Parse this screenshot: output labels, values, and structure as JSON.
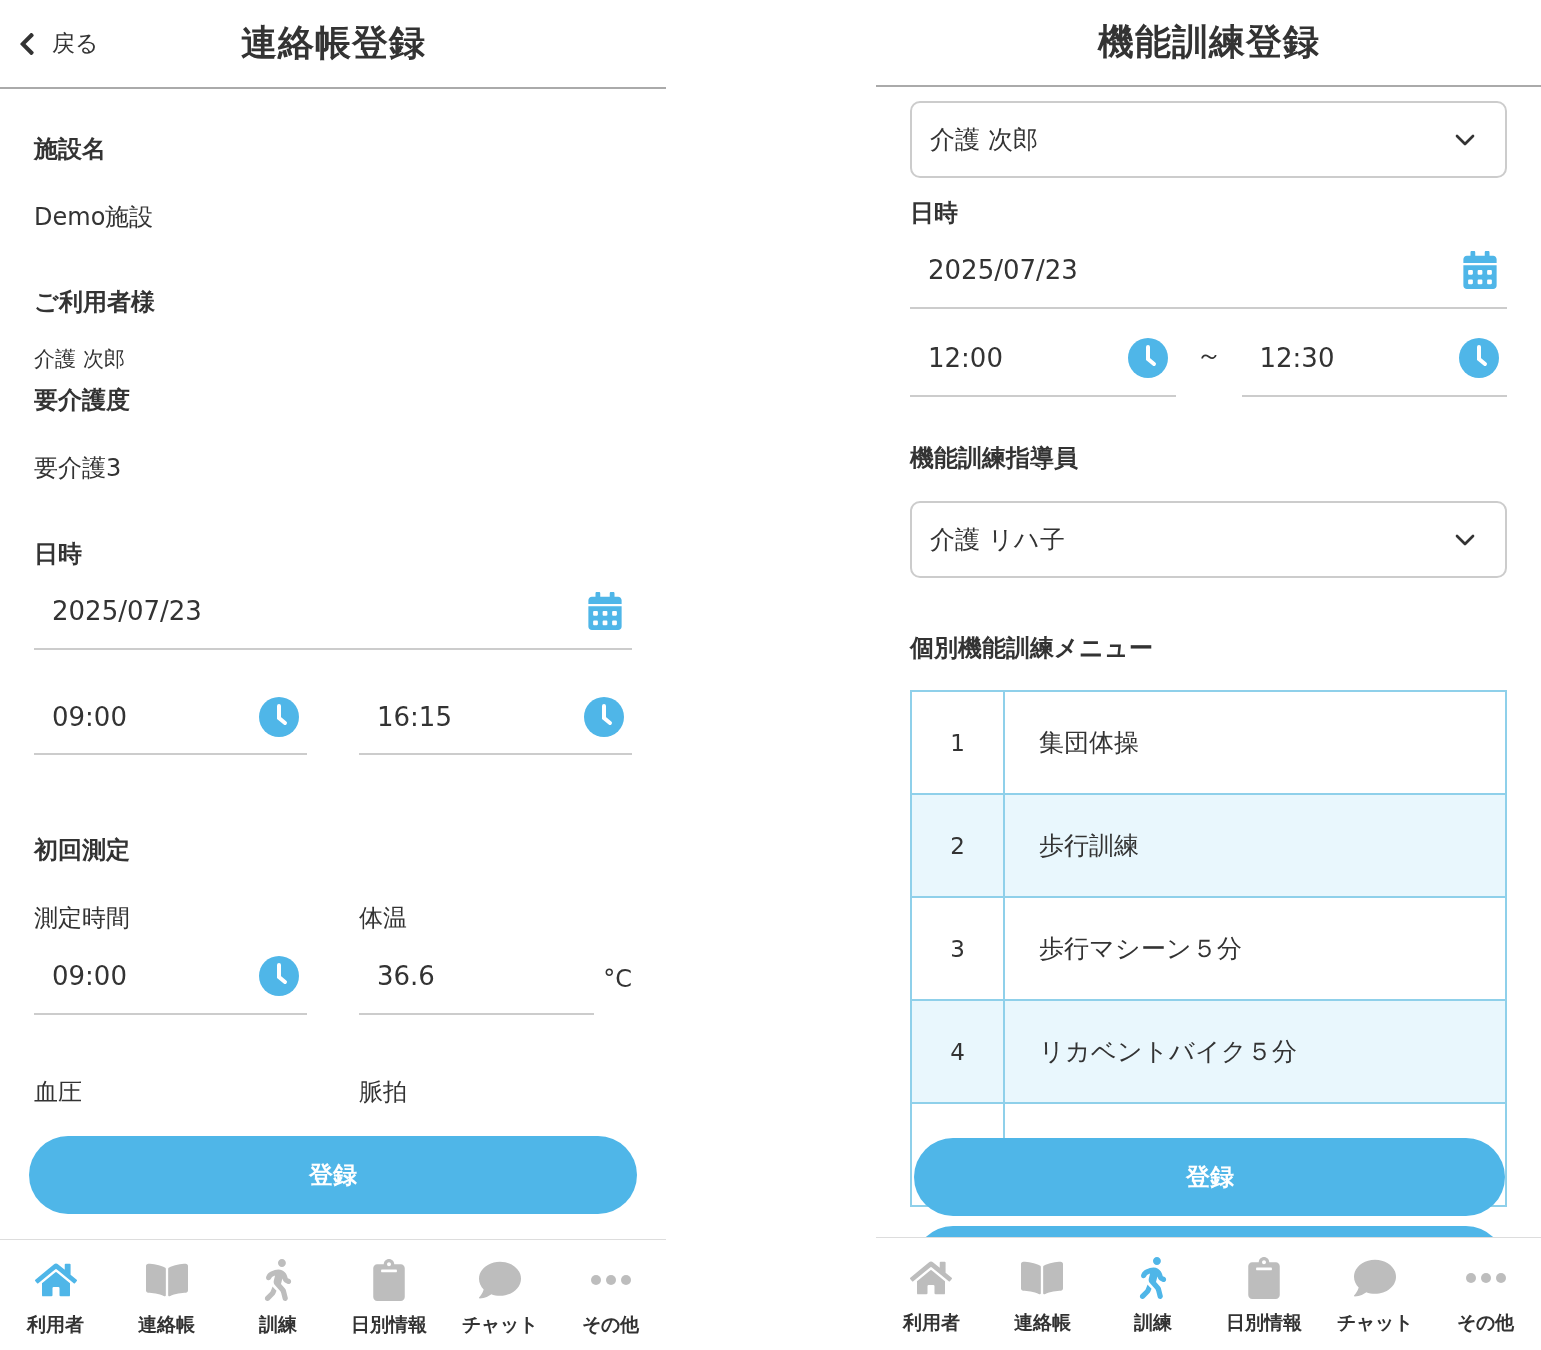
{
  "left": {
    "back": "戻る",
    "title": "連絡帳登録",
    "facility_label": "施設名",
    "facility": "Demo施設",
    "user_label": "ご利用者様",
    "user": "介護 次郎",
    "care_label": "要介護度",
    "care": "要介護3",
    "datetime_label": "日時",
    "date": "2025/07/23",
    "start": "09:00",
    "end": "16:15",
    "measure_title": "初回測定",
    "measure_time_label": "測定時間",
    "measure_time": "09:00",
    "temp_label": "体温",
    "temp": "36.6",
    "temp_unit": "°C",
    "bp_label": "血圧",
    "pulse_label": "脈拍",
    "submit": "登録",
    "tabs": [
      {
        "label": "利用者",
        "selected": true
      },
      {
        "label": "連絡帳",
        "selected": false
      },
      {
        "label": "訓練",
        "selected": false
      },
      {
        "label": "日別情報",
        "selected": false
      },
      {
        "label": "チャット",
        "selected": false
      },
      {
        "label": "その他",
        "selected": false
      }
    ]
  },
  "right": {
    "title": "機能訓練登録",
    "user_select": "介護 次郎",
    "datetime_label": "日時",
    "date": "2025/07/23",
    "start": "12:00",
    "tilde": "～",
    "end": "12:30",
    "instructor_label": "機能訓練指導員",
    "instructor": "介護 リハ子",
    "menu_label": "個別機能訓練メニュー",
    "menu": [
      {
        "no": "1",
        "name": "集団体操"
      },
      {
        "no": "2",
        "name": "歩行訓練"
      },
      {
        "no": "3",
        "name": "歩行マシーン５分"
      },
      {
        "no": "4",
        "name": "リカベントバイク５分"
      }
    ],
    "submit": "登録",
    "tabs": [
      {
        "label": "利用者",
        "selected": false
      },
      {
        "label": "連絡帳",
        "selected": false
      },
      {
        "label": "訓練",
        "selected": true
      },
      {
        "label": "日別情報",
        "selected": false
      },
      {
        "label": "チャット",
        "selected": false
      },
      {
        "label": "その他",
        "selected": false
      }
    ]
  }
}
